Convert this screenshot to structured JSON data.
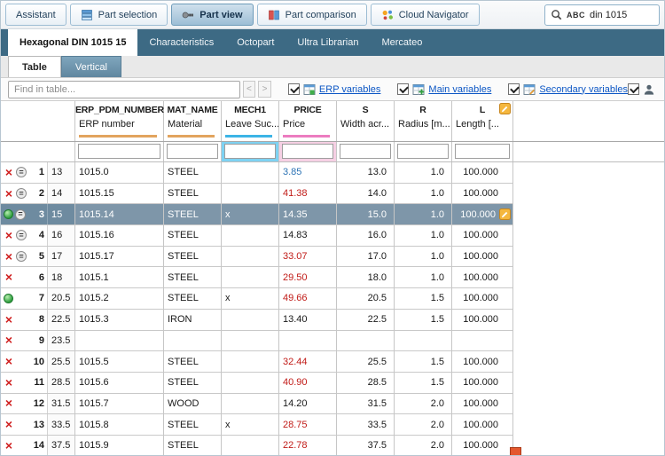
{
  "colors": {
    "red": "#c11b17",
    "blue": "#2e74b5",
    "black": "#1a1a1a",
    "selection": "#7e96a9",
    "column_tan": "#f6dab8",
    "column_blue": "#7ed2f2",
    "column_pink": "#f6d0e4",
    "accent_tan": "#e2a45e",
    "accent_blue": "#3cb4e6",
    "accent_pink": "#ec7cc0",
    "tab_bar": "#3d6a84"
  },
  "topbar": {
    "tabs": [
      {
        "label": "Assistant"
      },
      {
        "label": "Part selection"
      },
      {
        "label": "Part view"
      },
      {
        "label": "Part comparison"
      },
      {
        "label": "Cloud Navigator"
      }
    ],
    "search": {
      "mode": "ABC",
      "query": "din 1015"
    }
  },
  "doc_tabs": [
    {
      "label": "Hexagonal DIN 1015 15"
    },
    {
      "label": "Characteristics"
    },
    {
      "label": "Octopart"
    },
    {
      "label": "Ultra Librarian"
    },
    {
      "label": "Mercateo"
    }
  ],
  "view_tabs": [
    {
      "label": "Table"
    },
    {
      "label": "Vertical"
    }
  ],
  "find": {
    "placeholder": "Find in table...",
    "prev": "<",
    "next": ">"
  },
  "toggles": [
    {
      "label": "ERP variables",
      "checked": true
    },
    {
      "label": "Main variables",
      "checked": true
    },
    {
      "label": "Secondary variables",
      "checked": true
    },
    {
      "label": "",
      "checked": true
    }
  ],
  "table": {
    "columns": [
      {
        "code": "ERP_PDM_NUMBER",
        "desc": "ERP number"
      },
      {
        "code": "MAT_NAME",
        "desc": "Material"
      },
      {
        "code": "MECH1",
        "desc": "Leave Suc..."
      },
      {
        "code": "PRICE",
        "desc": "Price"
      },
      {
        "code": "S",
        "desc": "Width acr..."
      },
      {
        "code": "R",
        "desc": "Radius [m..."
      },
      {
        "code": "L",
        "desc": "Length [..."
      }
    ],
    "rows": [
      {
        "num": "1",
        "key": "13",
        "status_icon": "red-x",
        "equals_badge": true,
        "erp": "1015.0",
        "mat": "STEEL",
        "mech1": "",
        "price": "3.85",
        "price_color": "blue",
        "s": "13.0",
        "r": "1.0",
        "l": "100.000"
      },
      {
        "num": "2",
        "key": "14",
        "status_icon": "red-x",
        "equals_badge": true,
        "erp": "1015.15",
        "mat": "STEEL",
        "mech1": "",
        "price": "41.38",
        "price_color": "red",
        "s": "14.0",
        "r": "1.0",
        "l": "100.000"
      },
      {
        "num": "3",
        "key": "15",
        "status_icon": "green-dot",
        "equals_badge": true,
        "selected": true,
        "pencil": true,
        "erp": "1015.14",
        "mat": "STEEL",
        "mech1": "x",
        "price": "14.35",
        "price_color": "black",
        "s": "15.0",
        "r": "1.0",
        "l": "100.000"
      },
      {
        "num": "4",
        "key": "16",
        "status_icon": "red-x",
        "equals_badge": true,
        "erp": "1015.16",
        "mat": "STEEL",
        "mech1": "",
        "price": "14.83",
        "price_color": "black",
        "s": "16.0",
        "r": "1.0",
        "l": "100.000"
      },
      {
        "num": "5",
        "key": "17",
        "status_icon": "red-x",
        "equals_badge": true,
        "erp": "1015.17",
        "mat": "STEEL",
        "mech1": "",
        "price": "33.07",
        "price_color": "red",
        "s": "17.0",
        "r": "1.0",
        "l": "100.000"
      },
      {
        "num": "6",
        "key": "18",
        "status_icon": "red-x",
        "equals_badge": false,
        "erp": "1015.1",
        "mat": "STEEL",
        "mech1": "",
        "price": "29.50",
        "price_color": "red",
        "s": "18.0",
        "r": "1.0",
        "l": "100.000"
      },
      {
        "num": "7",
        "key": "20.5",
        "status_icon": "green-dot",
        "equals_badge": false,
        "erp": "1015.2",
        "mat": "STEEL",
        "mech1": "x",
        "price": "49.66",
        "price_color": "red",
        "s": "20.5",
        "r": "1.5",
        "l": "100.000"
      },
      {
        "num": "8",
        "key": "22.5",
        "status_icon": "red-x",
        "equals_badge": false,
        "erp": "1015.3",
        "mat": "IRON",
        "mech1": "",
        "price": "13.40",
        "price_color": "black",
        "s": "22.5",
        "r": "1.5",
        "l": "100.000"
      },
      {
        "num": "9",
        "key": "23.5",
        "status_icon": "red-x",
        "equals_badge": false,
        "erp": "",
        "mat": "",
        "mech1": "",
        "price": "",
        "price_color": "black",
        "s": "",
        "r": "",
        "l": ""
      },
      {
        "num": "10",
        "key": "25.5",
        "status_icon": "red-x",
        "equals_badge": false,
        "erp": "1015.5",
        "mat": "STEEL",
        "mech1": "",
        "price": "32.44",
        "price_color": "red",
        "s": "25.5",
        "r": "1.5",
        "l": "100.000"
      },
      {
        "num": "11",
        "key": "28.5",
        "status_icon": "red-x",
        "equals_badge": false,
        "erp": "1015.6",
        "mat": "STEEL",
        "mech1": "",
        "price": "40.90",
        "price_color": "red",
        "s": "28.5",
        "r": "1.5",
        "l": "100.000"
      },
      {
        "num": "12",
        "key": "31.5",
        "status_icon": "red-x",
        "equals_badge": false,
        "erp": "1015.7",
        "mat": "WOOD",
        "mech1": "",
        "price": "14.20",
        "price_color": "black",
        "s": "31.5",
        "r": "2.0",
        "l": "100.000"
      },
      {
        "num": "13",
        "key": "33.5",
        "status_icon": "red-x",
        "equals_badge": false,
        "erp": "1015.8",
        "mat": "STEEL",
        "mech1": "x",
        "price": "28.75",
        "price_color": "red",
        "s": "33.5",
        "r": "2.0",
        "l": "100.000"
      },
      {
        "num": "14",
        "key": "37.5",
        "status_icon": "red-x",
        "equals_badge": false,
        "erp": "1015.9",
        "mat": "STEEL",
        "mech1": "",
        "price": "22.78",
        "price_color": "red",
        "s": "37.5",
        "r": "2.0",
        "l": "100.000"
      }
    ]
  }
}
